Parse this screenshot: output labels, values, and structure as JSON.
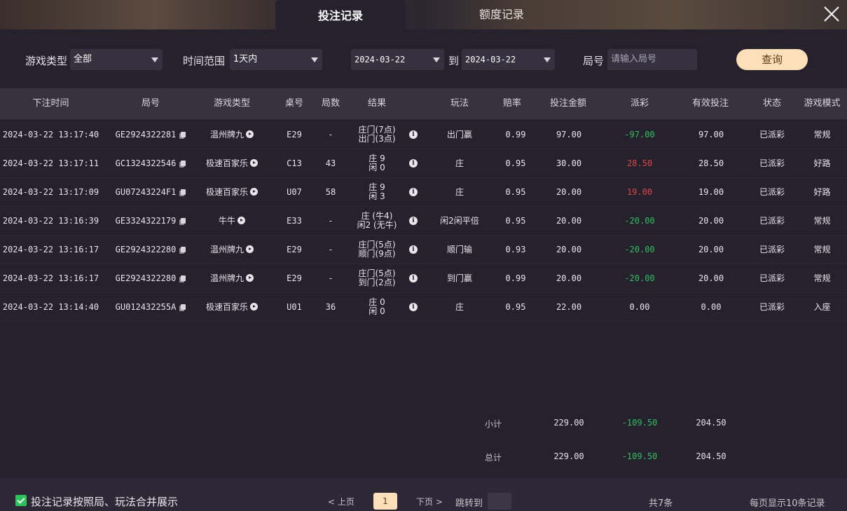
{
  "tabs": {
    "active": "投注记录",
    "inactive": "额度记录"
  },
  "filters": {
    "game_type_label": "游戏类型",
    "game_type_value": "全部",
    "time_range_label": "时间范围",
    "time_range_value": "1天内",
    "date_from": "2024-03-22",
    "to_label": "到",
    "date_to": "2024-03-22",
    "round_label": "局号",
    "round_placeholder": "请输入局号",
    "query_button": "查询"
  },
  "table": {
    "headers": [
      "下注时间",
      "局号",
      "游戏类型",
      "桌号",
      "局数",
      "结果",
      "玩法",
      "赔率",
      "投注金额",
      "派彩",
      "有效投注",
      "状态",
      "游戏模式"
    ],
    "rows": [
      {
        "time": "2024-03-22 13:17:40",
        "round": "GE2924322281",
        "game": "温州牌九",
        "table": "E29",
        "count": "-",
        "result1": "庄门(7点)",
        "result2": "出门(3点)",
        "play": "出门赢",
        "odds": "0.99",
        "bet": "97.00",
        "payout": "-97.00",
        "payout_color": "green",
        "valid": "97.00",
        "status": "已派彩",
        "mode": "常规"
      },
      {
        "time": "2024-03-22 13:17:11",
        "round": "GC1324322546",
        "game": "极速百家乐",
        "table": "C13",
        "count": "43",
        "result1": "庄 9",
        "result2": "闲 0",
        "play": "庄",
        "odds": "0.95",
        "bet": "30.00",
        "payout": "28.50",
        "payout_color": "red",
        "valid": "28.50",
        "status": "已派彩",
        "mode": "好路"
      },
      {
        "time": "2024-03-22 13:17:09",
        "round": "GU07243224F1",
        "game": "极速百家乐",
        "table": "U07",
        "count": "58",
        "result1": "庄 9",
        "result2": "闲 3",
        "play": "庄",
        "odds": "0.95",
        "bet": "20.00",
        "payout": "19.00",
        "payout_color": "red",
        "valid": "19.00",
        "status": "已派彩",
        "mode": "好路"
      },
      {
        "time": "2024-03-22 13:16:39",
        "round": "GE3324322179",
        "game": "牛牛",
        "table": "E33",
        "count": "-",
        "result1": "庄 (牛4)",
        "result2": "闲2 (无牛)",
        "play": "闲2闲平倍",
        "odds": "0.95",
        "bet": "20.00",
        "payout": "-20.00",
        "payout_color": "green",
        "valid": "20.00",
        "status": "已派彩",
        "mode": "常规"
      },
      {
        "time": "2024-03-22 13:16:17",
        "round": "GE2924322280",
        "game": "温州牌九",
        "table": "E29",
        "count": "-",
        "result1": "庄门(5点)",
        "result2": "顺门(9点)",
        "play": "顺门输",
        "odds": "0.93",
        "bet": "20.00",
        "payout": "-20.00",
        "payout_color": "green",
        "valid": "20.00",
        "status": "已派彩",
        "mode": "常规"
      },
      {
        "time": "2024-03-22 13:16:17",
        "round": "GE2924322280",
        "game": "温州牌九",
        "table": "E29",
        "count": "-",
        "result1": "庄门(5点)",
        "result2": "到门(2点)",
        "play": "到门赢",
        "odds": "0.99",
        "bet": "20.00",
        "payout": "-20.00",
        "payout_color": "green",
        "valid": "20.00",
        "status": "已派彩",
        "mode": "常规"
      },
      {
        "time": "2024-03-22 13:14:40",
        "round": "GU012432255A",
        "game": "极速百家乐",
        "table": "U01",
        "count": "36",
        "result1": "庄 0",
        "result2": "闲 0",
        "play": "庄",
        "odds": "0.95",
        "bet": "22.00",
        "payout": "0.00",
        "payout_color": "normal",
        "valid": "0.00",
        "status": "已派彩",
        "mode": "入座"
      }
    ]
  },
  "summary": {
    "subtotal_label": "小计",
    "subtotal_bet": "229.00",
    "subtotal_payout": "-109.50",
    "subtotal_valid": "204.50",
    "total_label": "总计",
    "total_bet": "229.00",
    "total_payout": "-109.50",
    "total_valid": "204.50"
  },
  "footer": {
    "merge_label": "投注记录按照局、玩法合并展示",
    "prev": "< 上页",
    "current_page": "1",
    "next": "下页 >",
    "jump_label": "跳转到",
    "total": "共7条",
    "per_page": "每页显示10条记录"
  },
  "colors": {
    "accent": "#fde0b8",
    "positive": "#e04646",
    "negative": "#2fbf62",
    "background": "#25212d"
  }
}
